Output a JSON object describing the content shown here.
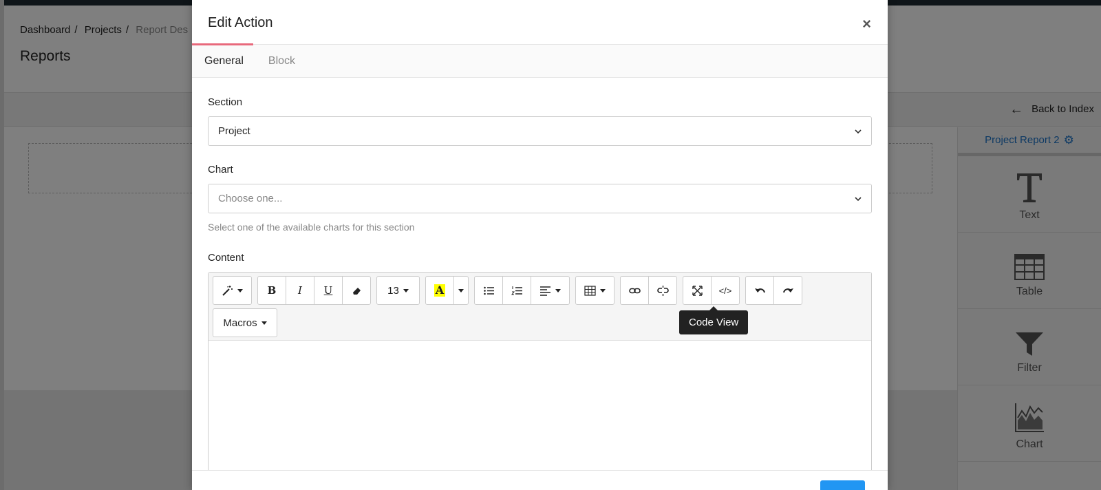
{
  "page": {
    "breadcrumb": [
      "Dashboard",
      "Projects",
      "Report Des"
    ],
    "title": "Reports",
    "back_link": "Back to Index",
    "sidebar": {
      "title": "Project Report 2",
      "items": [
        {
          "label": "Text",
          "icon": "text-icon"
        },
        {
          "label": "Table",
          "icon": "table-icon"
        },
        {
          "label": "Filter",
          "icon": "filter-icon"
        },
        {
          "label": "Chart",
          "icon": "chart-icon"
        }
      ]
    }
  },
  "modal": {
    "title": "Edit Action",
    "close": "×",
    "tabs": [
      "General",
      "Block"
    ],
    "active_tab": "General",
    "section": {
      "label": "Section",
      "value": "Project"
    },
    "chart": {
      "label": "Chart",
      "placeholder": "Choose one...",
      "help": "Select one of the available charts for this section"
    },
    "content": {
      "label": "Content",
      "font_size": "13",
      "highlight_glyph": "A",
      "macros_label": "Macros",
      "tooltip": "Code View"
    }
  },
  "colors": {
    "accent_tab": "#e8697c",
    "link_blue": "#1a73c8",
    "primary": "#2196f3",
    "highlight": "#ffff00"
  }
}
